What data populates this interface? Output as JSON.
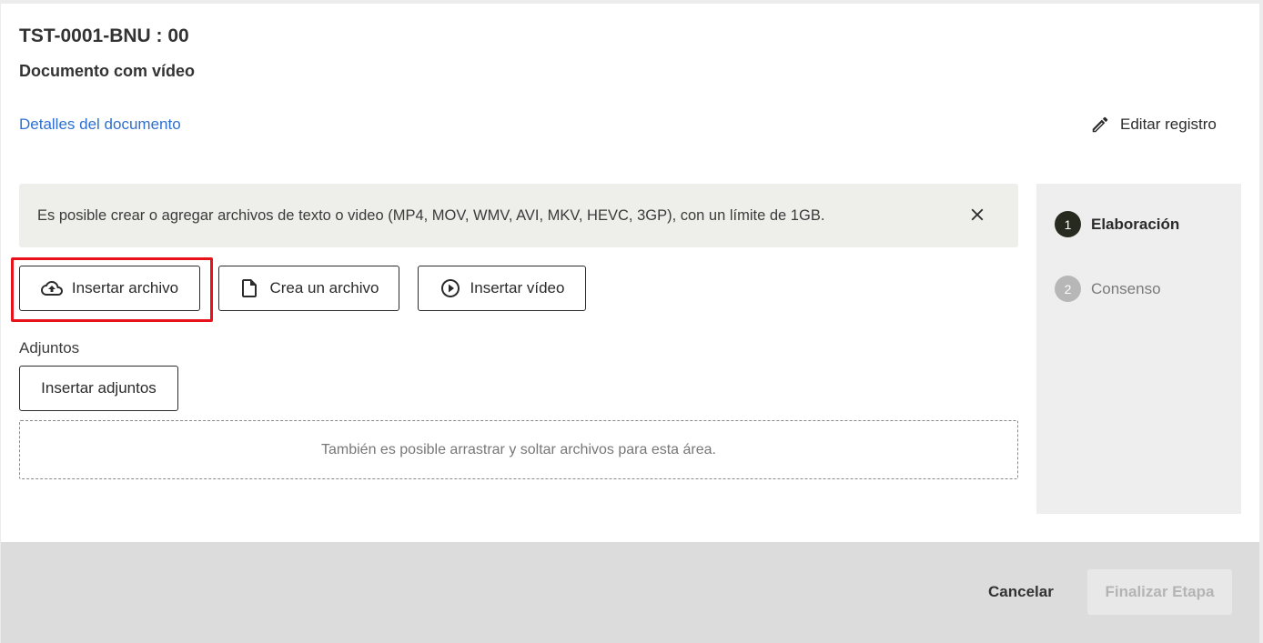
{
  "header": {
    "title": "TST-0001-BNU : 00",
    "subtitle": "Documento com vídeo",
    "details_link": "Detalles del documento",
    "edit_label": "Editar registro"
  },
  "notice": {
    "text": "Es posible crear o agregar archivos de texto o video (MP4, MOV, WMV, AVI, MKV, HEVC, 3GP), con un límite de 1GB."
  },
  "actions": {
    "insert_file": "Insertar archivo",
    "create_file": "Crea un archivo",
    "insert_video": "Insertar vídeo"
  },
  "attachments": {
    "label": "Adjuntos",
    "button": "Insertar adjuntos",
    "dropzone": "También es posible arrastrar y soltar archivos para esta área."
  },
  "steps": [
    {
      "number": "1",
      "label": "Elaboración",
      "status": "active"
    },
    {
      "number": "2",
      "label": "Consenso",
      "status": "pending"
    }
  ],
  "footer": {
    "cancel": "Cancelar",
    "finalize": "Finalizar Etapa"
  },
  "colors": {
    "link": "#2f6fd0",
    "highlight": "#e8121a",
    "active_step": "#262a1f"
  }
}
